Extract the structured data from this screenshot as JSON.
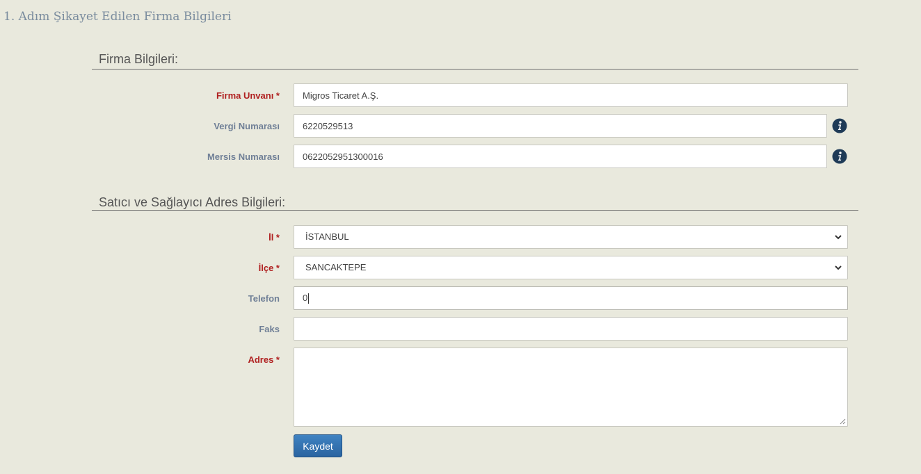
{
  "page": {
    "step_title": "1. Adım Şikayet Edilen Firma Bilgileri"
  },
  "firm_section": {
    "title": "Firma Bilgileri:",
    "firm_title": {
      "label": "Firma Unvanı *",
      "value": "Migros Ticaret A.Ş."
    },
    "tax_number": {
      "label": "Vergi Numarası",
      "value": "6220529513"
    },
    "mersis_number": {
      "label": "Mersis Numarası",
      "value": "0622052951300016"
    },
    "info_icon": "info-circle-icon"
  },
  "address_section": {
    "title": "Satıcı ve Sağlayıcı Adres Bilgileri:",
    "province": {
      "label": "İl *",
      "value": "İSTANBUL"
    },
    "district": {
      "label": "İlçe *",
      "value": "SANCAKTEPE"
    },
    "phone": {
      "label": "Telefon",
      "value": "0"
    },
    "fax": {
      "label": "Faks",
      "value": ""
    },
    "address": {
      "label": "Adres *",
      "value": ""
    }
  },
  "actions": {
    "save_label": "Kaydet"
  },
  "colors": {
    "background": "#e9e9dd",
    "required_label": "#b02020",
    "label": "#6f7f96",
    "button": "#2f6eab",
    "info_icon": "#1f3b57"
  }
}
